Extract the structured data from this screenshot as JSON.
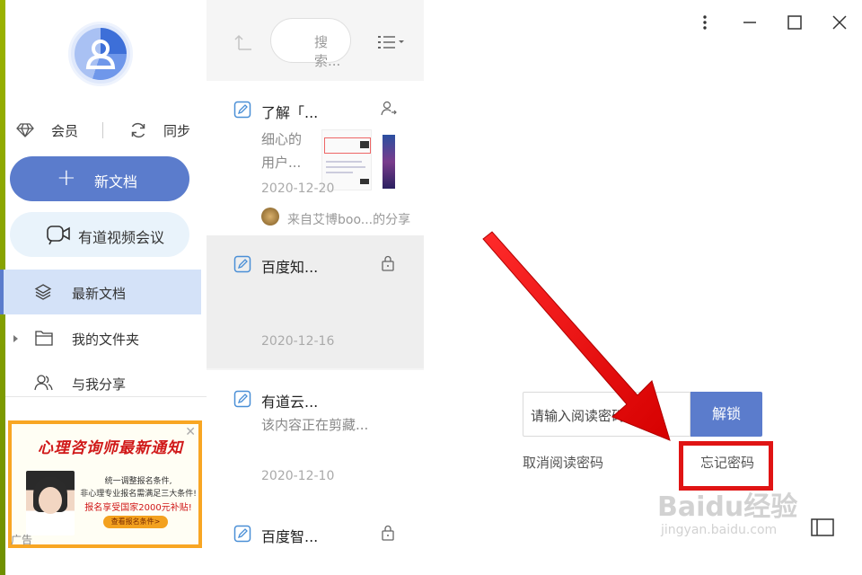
{
  "sidebar": {
    "vip_label": "会员",
    "sync_label": "同步",
    "new_doc_label": "新文档",
    "video_meeting_label": "有道视频会议",
    "nav": [
      {
        "label": "最新文档",
        "icon": "layers-icon",
        "selected": true
      },
      {
        "label": "我的文件夹",
        "icon": "folder-icon",
        "selected": false
      },
      {
        "label": "与我分享",
        "icon": "shared-users-icon",
        "selected": false
      }
    ]
  },
  "ad": {
    "title": "心理咨询师最新通知",
    "line1": "统一调整报名条件,",
    "line2": "非心理专业报名需满足三大条件!",
    "line3": "报名享受国家2000元补贴!",
    "button": "查看报名条件>",
    "tag": "广告"
  },
  "list": {
    "search_placeholder": "搜索...",
    "items": [
      {
        "title": "了解「...",
        "snippet1": "细心的",
        "snippet2": "用户...",
        "date": "2020-12-20",
        "shared_from": "来自艾博boo...的分享"
      },
      {
        "title": "百度知...",
        "date": "2020-12-16",
        "locked": true
      },
      {
        "title": "有道云...",
        "snippet1": "该内容正在剪藏...",
        "date": "2020-12-10"
      },
      {
        "title": "百度智...",
        "locked": true
      }
    ]
  },
  "window": {
    "more_icon": "more-vertical-icon",
    "maximize_icon": "maximize-icon",
    "close_icon": "close-icon"
  },
  "unlock": {
    "password_placeholder": "请输入阅读密码",
    "unlock_button": "解锁",
    "cancel_link": "取消阅读密码",
    "forgot_link": "忘记密码"
  },
  "watermark": {
    "main": "Baidu经验",
    "sub": "jingyan.baidu.com"
  },
  "colors": {
    "accent": "#5b7ccc",
    "highlight": "#e01414"
  }
}
